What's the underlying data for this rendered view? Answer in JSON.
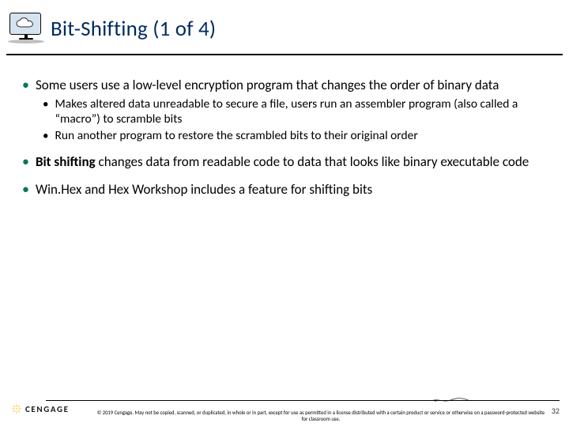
{
  "title": "Bit-Shifting (1 of 4)",
  "bullets": {
    "a": "Some users use a low-level encryption program that changes the order of binary data",
    "a_sub1": "Makes altered data unreadable to secure a file, users run an assembler program (also called a “macro”) to scramble bits",
    "a_sub2": "Run another program to restore the scrambled bits to their original order",
    "b_pre": "Bit shifting",
    "b_post": " changes data from readable code to data that looks like binary executable code",
    "c": "Win.Hex and Hex Workshop includes a feature for shifting bits"
  },
  "footer": {
    "brand": "CENGAGE",
    "copyright": "© 2019 Cengage. May not be copied, scanned, or duplicated, in whole or in part, except for use as permitted in a license distributed with a certain product or service or otherwise on a password-protected website for classroom use.",
    "page": "32"
  }
}
